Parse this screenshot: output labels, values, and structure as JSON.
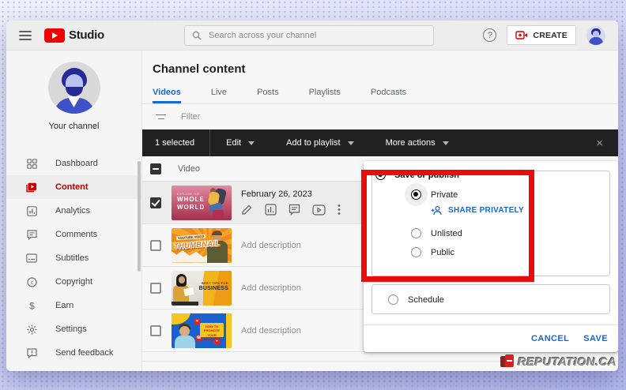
{
  "topbar": {
    "logo_text": "Studio",
    "search_placeholder": "Search across your channel",
    "help_label": "?",
    "create_label": "CREATE"
  },
  "sidebar": {
    "channel_label": "Your channel",
    "items": [
      {
        "label": "Dashboard",
        "selected": false
      },
      {
        "label": "Content",
        "selected": true
      },
      {
        "label": "Analytics",
        "selected": false
      },
      {
        "label": "Comments",
        "selected": false
      },
      {
        "label": "Subtitles",
        "selected": false
      },
      {
        "label": "Copyright",
        "selected": false
      },
      {
        "label": "Earn",
        "selected": false
      },
      {
        "label": "Settings",
        "selected": false
      },
      {
        "label": "Send feedback",
        "selected": false
      }
    ]
  },
  "content": {
    "title": "Channel content",
    "tabs": [
      {
        "label": "Videos",
        "active": true
      },
      {
        "label": "Live",
        "active": false
      },
      {
        "label": "Posts",
        "active": false
      },
      {
        "label": "Playlists",
        "active": false
      },
      {
        "label": "Podcasts",
        "active": false
      }
    ],
    "filter_label": "Filter"
  },
  "action_bar": {
    "selected_count": "1 selected",
    "items": [
      {
        "label": "Edit"
      },
      {
        "label": "Add to playlist"
      },
      {
        "label": "More actions"
      }
    ],
    "close_glyph": "×"
  },
  "table": {
    "header_label": "Video",
    "rows": [
      {
        "checked": true,
        "date": "February 26, 2023",
        "thumb_lines": [
          "EXPLORE THE",
          "WHOLE",
          "WORLD"
        ]
      },
      {
        "checked": false,
        "description": "Add description",
        "thumb_lines": [
          "YOUTUBE VIDEO",
          "THUMBNAIL"
        ]
      },
      {
        "checked": false,
        "description": "Add description",
        "thumb_lines": [
          "BEST TIPS FOR",
          "BUSINESS"
        ]
      },
      {
        "checked": false,
        "description": "Add description",
        "thumb_lines": [
          "HOW TO PROMOTE",
          "YOUR BUSINESS"
        ]
      }
    ]
  },
  "visibility_panel": {
    "title": "Save or publish",
    "options": [
      {
        "label": "Private",
        "checked": true
      },
      {
        "label": "Unlisted",
        "checked": false
      },
      {
        "label": "Public",
        "checked": false
      }
    ],
    "share_label": "SHARE PRIVATELY",
    "schedule_label": "Schedule",
    "cancel_label": "CANCEL",
    "save_label": "SAVE"
  },
  "watermark": {
    "text": "REPUTATION.CA"
  },
  "colors": {
    "accent_blue": "#1967d2",
    "brand_red": "#f00000",
    "selected_red_text": "#b70000",
    "annotation_red": "#ea0c0c",
    "action_bar_bg": "#212121"
  }
}
